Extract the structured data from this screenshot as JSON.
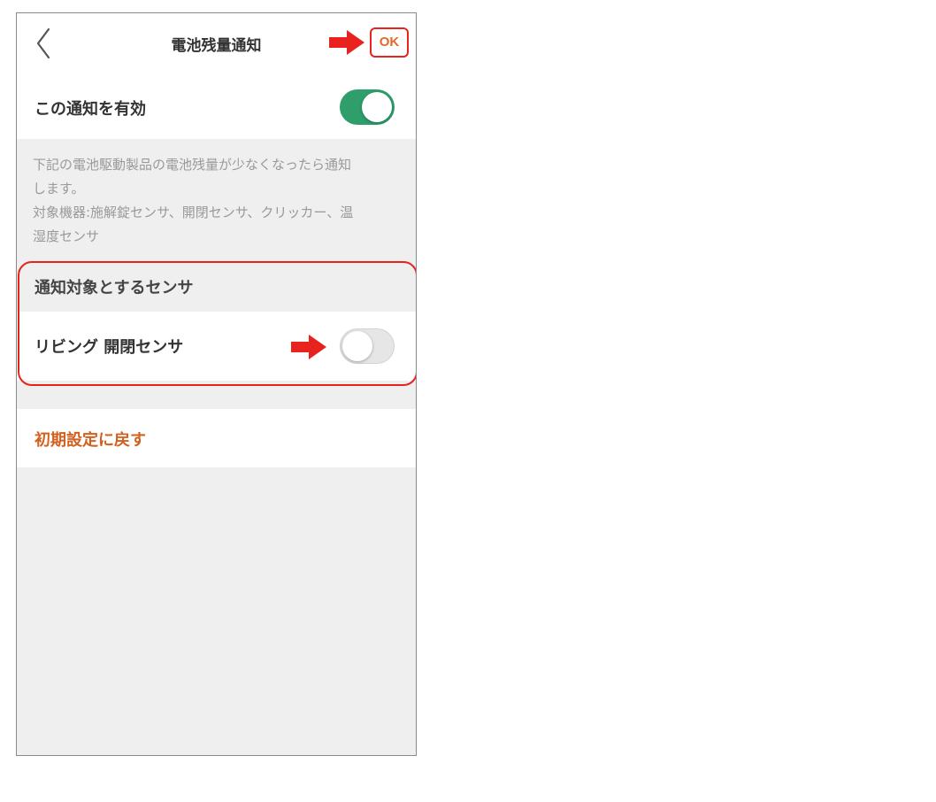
{
  "header": {
    "title": "電池残量通知",
    "ok_label": "OK"
  },
  "enable": {
    "label": "この通知を有効",
    "state": "on"
  },
  "description": {
    "line1": "下記の電池駆動製品の電池残量が少なくなったら通知",
    "line2": "します。",
    "line3": "対象機器:施解錠センサ、開閉センサ、クリッカー、温",
    "line4": "湿度センサ"
  },
  "sensors": {
    "section_title": "通知対象とするセンサ",
    "items": [
      {
        "label": "リビング 開閉センサ",
        "state": "off"
      }
    ]
  },
  "reset": {
    "label": "初期設定に戻す"
  },
  "colors": {
    "accent_orange": "#d2601f",
    "toggle_on": "#2f9e6a",
    "highlight_red": "#e8231e"
  },
  "icons": {
    "back": "chevron-left-icon",
    "annotation": "red-arrow-icon"
  }
}
